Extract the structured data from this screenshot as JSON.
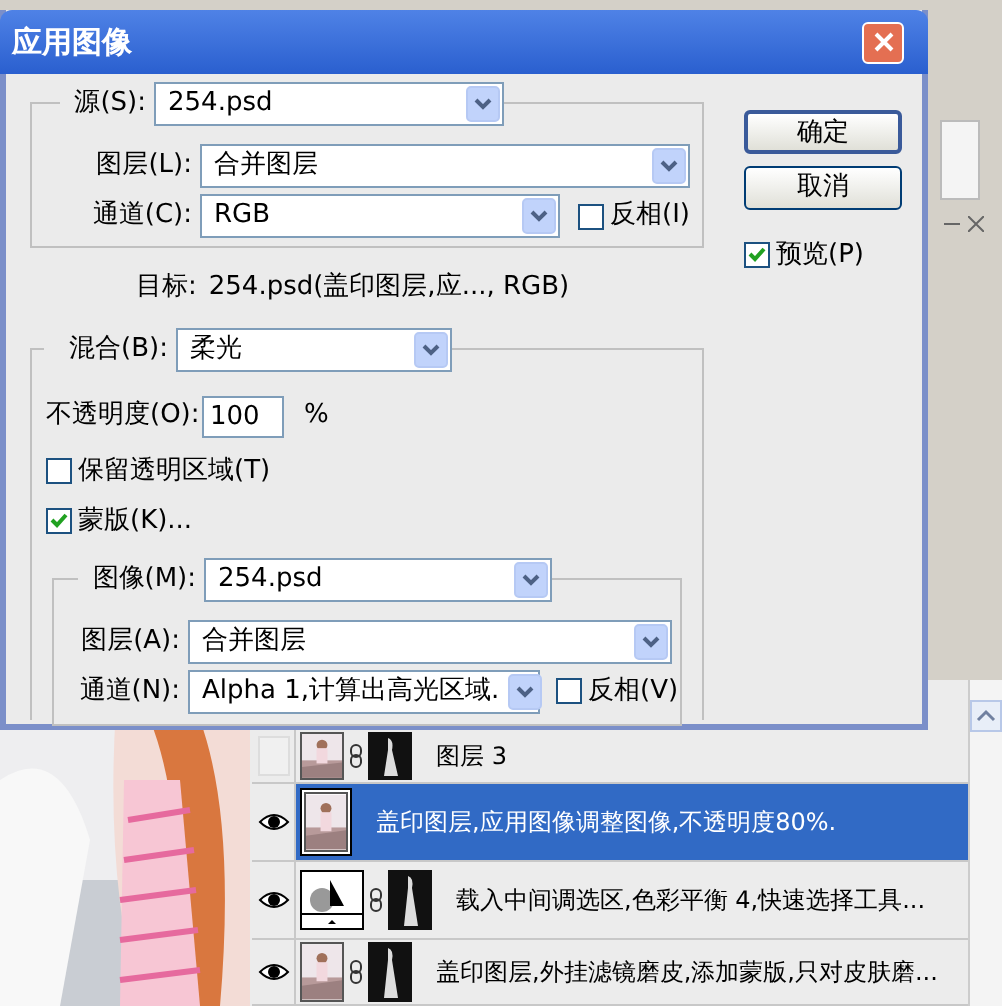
{
  "dialog": {
    "title": "应用图像",
    "source": {
      "label": "源(S):",
      "value": "254.psd"
    },
    "layer": {
      "label": "图层(L):",
      "value": "合并图层"
    },
    "channel": {
      "label": "通道(C):",
      "value": "RGB"
    },
    "invert": {
      "label": "反相(I)",
      "checked": false
    },
    "target": {
      "label": "目标:",
      "value": "254.psd(盖印图层,应..., RGB)"
    },
    "blending": {
      "label": "混合(B):",
      "value": "柔光"
    },
    "opacity": {
      "label": "不透明度(O):",
      "value": "100",
      "unit": "%"
    },
    "preserve_transparency": {
      "label": "保留透明区域(T)",
      "checked": false
    },
    "mask": {
      "label": "蒙版(K)...",
      "checked": true,
      "image": {
        "label": "图像(M):",
        "value": "254.psd"
      },
      "layer": {
        "label": "图层(A):",
        "value": "合并图层"
      },
      "channel": {
        "label": "通道(N):",
        "value": "Alpha 1,计算出高光区域."
      },
      "invert": {
        "label": "反相(V)",
        "checked": false
      }
    },
    "buttons": [
      {
        "label": "确定",
        "default": true
      },
      {
        "label": "取消",
        "default": false
      }
    ],
    "preview": {
      "label": "预览(P)",
      "checked": true
    }
  },
  "layers": [
    {
      "name": "图层 3",
      "kind": "masked",
      "visible": false,
      "selected": false
    },
    {
      "name": "盖印图层,应用图像调整图像,不透明度80%.",
      "kind": "plain",
      "visible": true,
      "selected": true
    },
    {
      "name": "载入中间调选区,色彩平衡 4,快速选择工具...",
      "kind": "adjustment",
      "visible": true,
      "selected": false
    },
    {
      "name": "盖印图层,外挂滤镜磨皮,添加蒙版,只对皮肤磨...",
      "kind": "masked",
      "visible": true,
      "selected": false
    }
  ]
}
